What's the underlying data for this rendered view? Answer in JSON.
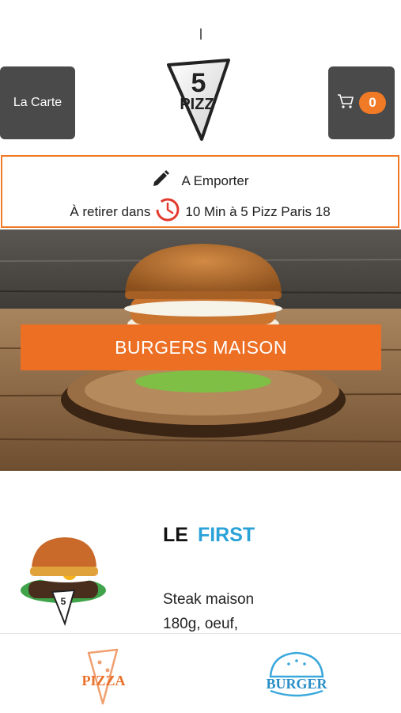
{
  "header": {
    "menu_label": "La Carte",
    "cart_count": "0",
    "logo_text": "PIZZ",
    "logo_number": "5"
  },
  "order_info": {
    "mode": "A Emporter",
    "pickup_prefix": "À retirer dans",
    "pickup_detail": "10 Min à 5 Pizz Paris 18"
  },
  "hero": {
    "category_title": "BURGERS MAISON"
  },
  "product": {
    "title_part1": "LE",
    "title_part2": "FIRST",
    "description_line1": "Steak maison",
    "description_line2": "180g, oeuf,"
  },
  "bottom_nav": {
    "pizza_label": "PIZZA",
    "burger_label": "BURGER"
  },
  "colors": {
    "accent_orange": "#ec6f24",
    "title_blue": "#2aa2d8",
    "button_dark": "#4a4a4a"
  }
}
